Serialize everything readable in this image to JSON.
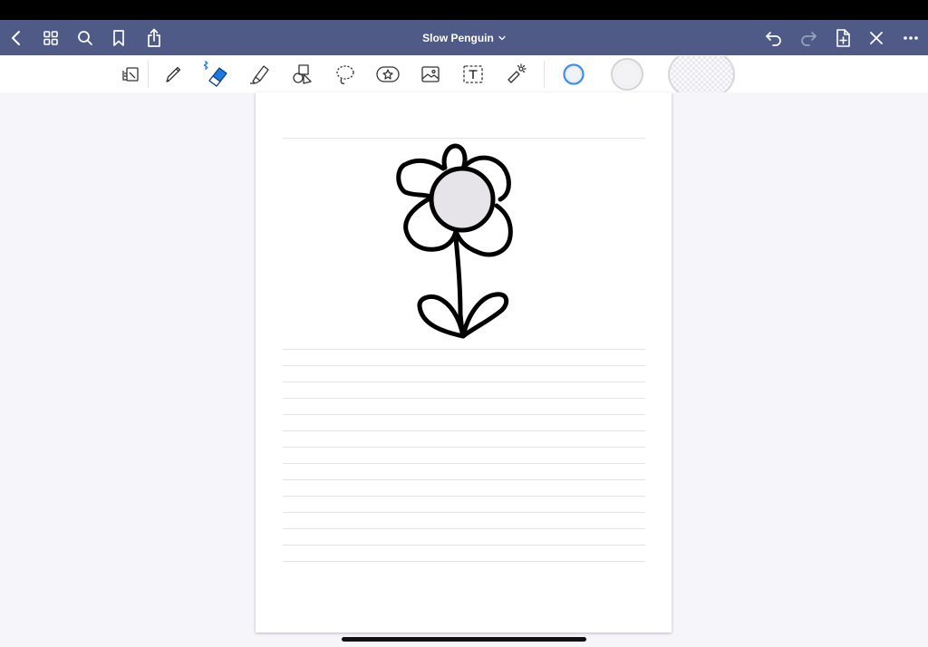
{
  "navbar": {
    "title": "Slow Penguin",
    "background": "#4f5a86",
    "left_icons": [
      "back-icon",
      "grid-icon",
      "search-icon",
      "bookmark-icon",
      "share-icon"
    ],
    "right_icons": [
      "undo-icon",
      "redo-icon",
      "add-page-icon",
      "close-icon",
      "more-icon"
    ]
  },
  "toolbar": {
    "tools": [
      "page-layout-icon",
      "pen-icon",
      "eraser-icon",
      "highlighter-icon",
      "shapes-icon",
      "lasso-icon",
      "elements-icon",
      "image-icon",
      "text-icon",
      "laser-pointer-icon"
    ],
    "selected_tool": "eraser-icon",
    "accent": "#1f7ae0",
    "eraser_sizes": [
      "small",
      "medium",
      "large"
    ],
    "selected_size": "small"
  },
  "document": {
    "drawing": "flower",
    "flower_center_color": "#e6e4e8"
  }
}
